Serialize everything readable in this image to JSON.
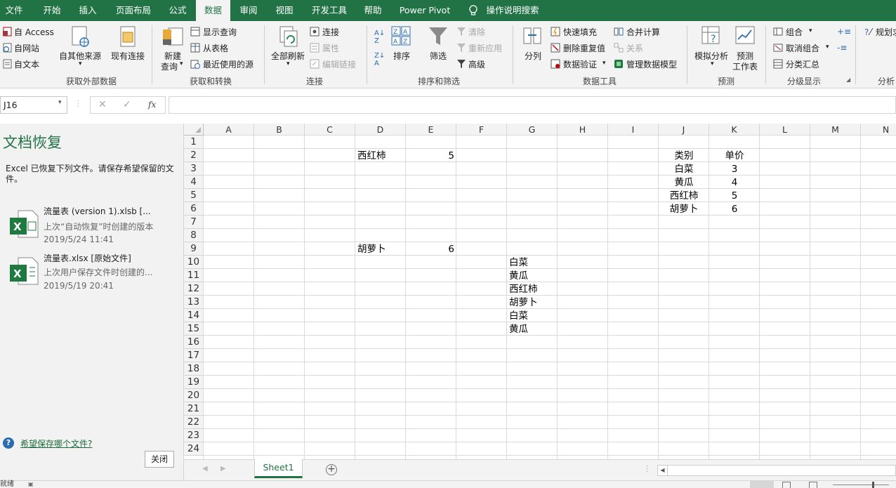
{
  "menu": {
    "tabs": [
      {
        "label": "文件"
      },
      {
        "label": "开始"
      },
      {
        "label": "插入"
      },
      {
        "label": "页面布局"
      },
      {
        "label": "公式"
      },
      {
        "label": "数据"
      },
      {
        "label": "审阅"
      },
      {
        "label": "视图"
      },
      {
        "label": "开发工具"
      },
      {
        "label": "帮助"
      },
      {
        "label": "Power Pivot"
      },
      {
        "label": "操作说明搜索"
      }
    ],
    "active_tab": "数据"
  },
  "ribbon": {
    "get_external": {
      "access": "自 Access",
      "web": "自网站",
      "text": "自文本",
      "other_sources": "自其他来源",
      "existing_conn": "现有连接",
      "group": "获取外部数据"
    },
    "get_transform": {
      "new_query_1": "新建",
      "new_query_2": "查询",
      "show_queries": "显示查询",
      "from_table": "从表格",
      "recent_sources": "最近使用的源",
      "group": "获取和转换"
    },
    "connections": {
      "refresh_all": "全部刷新",
      "connections": "连接",
      "properties": "属性",
      "edit_links": "编辑链接",
      "group": "连接"
    },
    "sort_filter": {
      "sort": "排序",
      "filter": "筛选",
      "clear": "清除",
      "reapply": "重新应用",
      "advanced": "高级",
      "group": "排序和筛选"
    },
    "data_tools": {
      "text_to_columns": "分列",
      "flash_fill": "快速填充",
      "remove_duplicates": "删除重复值",
      "data_validation": "数据验证",
      "consolidate": "合并计算",
      "relationships": "关系",
      "manage_model": "管理数据模型",
      "group": "数据工具"
    },
    "forecast": {
      "what_if": "模拟分析",
      "forecast_sheet_1": "预测",
      "forecast_sheet_2": "工作表",
      "group": "预测"
    },
    "outline": {
      "group_btn": "组合",
      "ungroup": "取消组合",
      "subtotal": "分类汇总",
      "group": "分级显示"
    },
    "analysis": {
      "solver": "规划求",
      "group": "分析"
    }
  },
  "formula_bar": {
    "name_box": "J16",
    "cancel": "✕",
    "enter": "✓",
    "fx": "fx",
    "content": ""
  },
  "recovery_pane": {
    "title": "文档恢复",
    "description": "Excel 已恢复下列文件。请保存希望保留的文件。",
    "files": [
      {
        "name": "流量表 (version 1).xlsb  [...",
        "desc": "上次“自动恢复”时创建的版本",
        "time": "2019/5/24 11:41"
      },
      {
        "name": "流量表.xlsx  [原始文件]",
        "desc": "上次用户保存文件时创建的...",
        "time": "2019/5/19 20:41"
      }
    ],
    "help_link": "希望保存哪个文件?",
    "close_button": "关闭"
  },
  "sheet": {
    "columns": [
      "A",
      "B",
      "C",
      "D",
      "E",
      "F",
      "G",
      "H",
      "I",
      "J",
      "K",
      "L",
      "M",
      "N"
    ],
    "rows": [
      "1",
      "2",
      "3",
      "4",
      "5",
      "6",
      "7",
      "8",
      "9",
      "10",
      "11",
      "12",
      "13",
      "14",
      "15",
      "16",
      "17",
      "18",
      "19",
      "20",
      "21",
      "22",
      "23",
      "24"
    ],
    "cells": [
      {
        "ref": "D2",
        "value": "西红柿"
      },
      {
        "ref": "E2",
        "value": "5"
      },
      {
        "ref": "D9",
        "value": "胡萝卜"
      },
      {
        "ref": "E9",
        "value": "6"
      },
      {
        "ref": "J2",
        "value": "类别"
      },
      {
        "ref": "K2",
        "value": "单价"
      },
      {
        "ref": "J3",
        "value": "白菜"
      },
      {
        "ref": "K3",
        "value": "3"
      },
      {
        "ref": "J4",
        "value": "黄瓜"
      },
      {
        "ref": "K4",
        "value": "4"
      },
      {
        "ref": "J5",
        "value": "西红柿"
      },
      {
        "ref": "K5",
        "value": "5"
      },
      {
        "ref": "J6",
        "value": "胡萝卜"
      },
      {
        "ref": "K6",
        "value": "6"
      },
      {
        "ref": "G10",
        "value": "白菜"
      },
      {
        "ref": "G11",
        "value": "黄瓜"
      },
      {
        "ref": "G12",
        "value": "西红柿"
      },
      {
        "ref": "G13",
        "value": "胡萝卜"
      },
      {
        "ref": "G14",
        "value": "白菜"
      },
      {
        "ref": "G15",
        "value": "黄瓜"
      }
    ]
  },
  "sheet_tabs": {
    "active": "Sheet1"
  },
  "status_bar": {
    "ready": "就绪"
  },
  "colors": {
    "accent": "#217346",
    "ribbon_bg": "#f3f3f3"
  }
}
